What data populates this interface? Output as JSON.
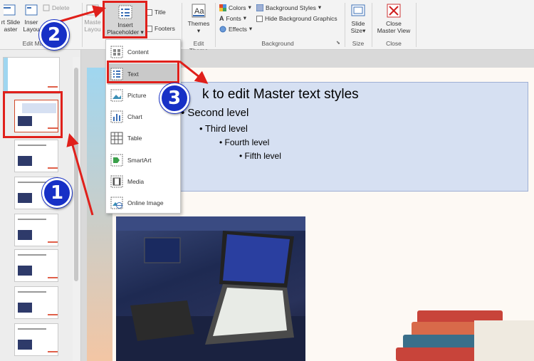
{
  "ribbon": {
    "insert_slide_master": "rt Slide\naster",
    "insert_layout": "Inser\nLayou",
    "delete": "Delete",
    "edit_master_label": "Edit Ma",
    "master_layout": "Maste\nLayou",
    "insert_placeholder_line1": "Insert",
    "insert_placeholder_line2": "Placeholder",
    "title_checkbox": "Title",
    "footers_checkbox": "Footers",
    "themes": "Themes",
    "edit_theme_label": "Edit Theme",
    "colors": "Colors",
    "fonts": "Fonts",
    "effects": "Effects",
    "background_styles": "Background Styles",
    "hide_background_graphics": "Hide Background Graphics",
    "background_label": "Background",
    "slide_size_line1": "Slide",
    "slide_size_line2": "Size",
    "size_label": "Size",
    "close_master_line1": "Close",
    "close_master_line2": "Master View",
    "close_label": "Close"
  },
  "placeholder_menu": [
    {
      "label": "Content",
      "icon": "content-placeholder-icon"
    },
    {
      "label": "Text",
      "icon": "text-placeholder-icon"
    },
    {
      "label": "Picture",
      "icon": "picture-placeholder-icon"
    },
    {
      "label": "Chart",
      "icon": "chart-placeholder-icon"
    },
    {
      "label": "Table",
      "icon": "table-placeholder-icon"
    },
    {
      "label": "SmartArt",
      "icon": "smartart-placeholder-icon"
    },
    {
      "label": "Media",
      "icon": "media-placeholder-icon"
    },
    {
      "label": "Online Image",
      "icon": "online-image-placeholder-icon"
    }
  ],
  "slide": {
    "level1": "k to edit Master text styles",
    "level2": "Second level",
    "level3": "Third level",
    "level4": "Fourth level",
    "level5": "Fifth level"
  },
  "callouts": {
    "one": "1",
    "two": "2",
    "three": "3"
  },
  "colors": {
    "highlight": "#e0201b",
    "badge": "#1730c6",
    "placeholder_fill": "#d6e0f2"
  }
}
